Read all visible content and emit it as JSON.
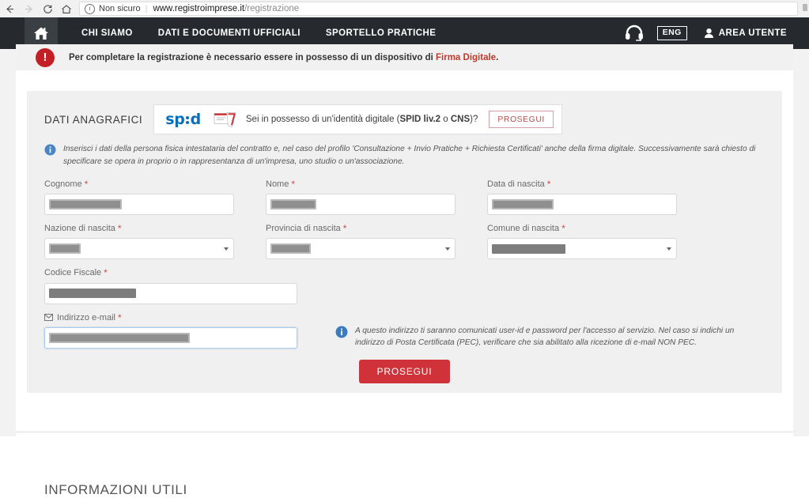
{
  "browser": {
    "back_icon": "back-arrow-icon",
    "forward_icon": "forward-arrow-icon",
    "reload_icon": "reload-icon",
    "home_icon": "home-icon",
    "security_label": "Non sicuro",
    "url_domain": "www.registroimprese.it",
    "url_path": "/registrazione"
  },
  "site_header": {
    "home_icon": "home-icon",
    "nav": [
      {
        "label": "CHI SIAMO"
      },
      {
        "label": "DATI E DOCUMENTI UFFICIALI"
      },
      {
        "label": "SPORTELLO PRATICHE"
      }
    ],
    "support_icon": "headset-icon",
    "language": "ENG",
    "user_icon": "person-icon",
    "user_area": "AREA UTENTE"
  },
  "alert": {
    "icon": "exclamation-icon",
    "text_before": "Per completare la registrazione è necessario essere in possesso di un dispositivo di ",
    "link_text": "Firma Digitale",
    "text_after": "."
  },
  "spid_row": {
    "section_title": "DATI ANAGRAFICI",
    "logo_text": "spid",
    "card_icon": "smart-card-icon",
    "question_plain_1": "Sei in possesso di un'identità digitale (",
    "question_bold_1": "SPID liv.2",
    "question_plain_2": " o ",
    "question_bold_2": "CNS",
    "question_plain_3": ")?",
    "button_label": "PROSEGUI"
  },
  "info_note": {
    "icon": "info-icon",
    "text": "Inserisci i dati della persona fisica intestataria del contratto e, nel caso del profilo 'Consultazione + Invio Pratiche + Richiesta Certificati' anche della firma digitale. Successivamente sarà chiesto di specificare se opera in proprio o in rappresentanza di un'impresa, uno studio o un'associazione."
  },
  "form": {
    "required_marker": "*",
    "fields": {
      "cognome": {
        "label": "Cognome",
        "value": "",
        "type": "text"
      },
      "nome": {
        "label": "Nome",
        "value": "",
        "type": "text"
      },
      "data_nascita": {
        "label": "Data di nascita",
        "value": "",
        "type": "text"
      },
      "nazione_nascita": {
        "label": "Nazione di nascita",
        "value": "",
        "type": "select"
      },
      "provincia_nascita": {
        "label": "Provincia di nascita",
        "value": "",
        "type": "select"
      },
      "comune_nascita": {
        "label": "Comune di nascita",
        "value": "",
        "type": "select"
      },
      "codice_fiscale": {
        "label": "Codice Fiscale",
        "value": "",
        "type": "text"
      },
      "email": {
        "label": "Indirizzo e-mail",
        "value": "",
        "type": "email",
        "icon": "envelope-icon"
      }
    },
    "email_note": {
      "icon": "info-icon",
      "text": "A questo indirizzo ti saranno comunicati user-id e password per l'accesso al servizio. Nel caso si indichi un indirizzo di Posta Certificata (PEC), verificare che sia abilitato alla ricezione di e-mail NON PEC."
    },
    "submit_label": "PROSEGUI"
  },
  "footer": {
    "heading": "INFORMAZIONI UTILI"
  },
  "colors": {
    "header_bg": "#262a2e",
    "alert_red": "#c32026",
    "link_red": "#c0392b",
    "button_red": "#cf3339",
    "spid_blue": "#0a6fb8",
    "info_blue": "#3a7bbf"
  }
}
